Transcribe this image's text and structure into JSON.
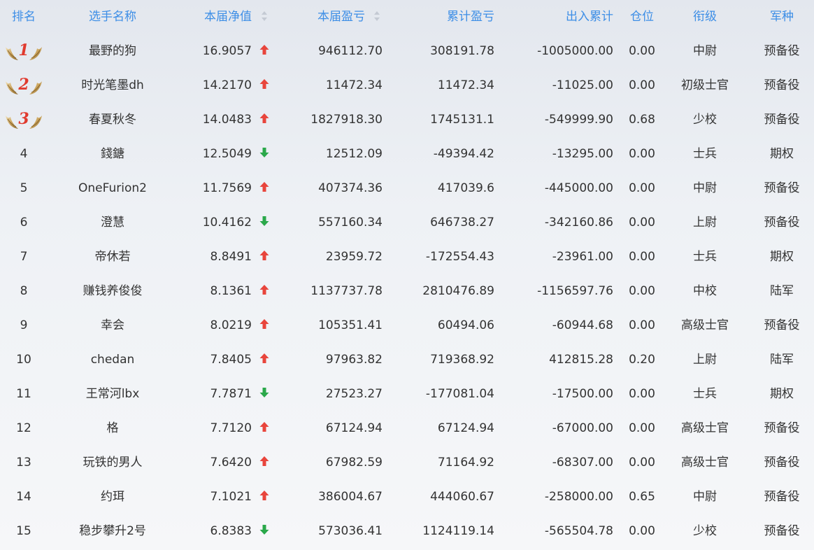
{
  "header": {
    "rank": "排名",
    "name": "选手名称",
    "nav": "本届净值",
    "current_pnl": "本届盈亏",
    "cumulative_pnl": "累计盈亏",
    "inout": "出入累计",
    "position": "仓位",
    "title": "衔级",
    "branch": "军种"
  },
  "colors": {
    "header_text": "#3d8ee6",
    "up_arrow": "#e8453c",
    "down_arrow": "#2aa84a",
    "medal_number": "#e03a2e",
    "sort_icon": "#c4cad3"
  },
  "rows": [
    {
      "rank": "1",
      "medal": true,
      "name": "最野的狗",
      "nav": "16.9057",
      "trend": "up",
      "current_pnl": "946112.70",
      "cumulative_pnl": "308191.78",
      "inout": "-1005000.00",
      "position": "0.00",
      "title": "中尉",
      "branch": "预备役"
    },
    {
      "rank": "2",
      "medal": true,
      "name": "时光笔墨dh",
      "nav": "14.2170",
      "trend": "up",
      "current_pnl": "11472.34",
      "cumulative_pnl": "11472.34",
      "inout": "-11025.00",
      "position": "0.00",
      "title": "初级士官",
      "branch": "预备役"
    },
    {
      "rank": "3",
      "medal": true,
      "name": "春夏秋冬",
      "nav": "14.0483",
      "trend": "up",
      "current_pnl": "1827918.30",
      "cumulative_pnl": "1745131.1",
      "inout": "-549999.90",
      "position": "0.68",
      "title": "少校",
      "branch": "预备役"
    },
    {
      "rank": "4",
      "medal": false,
      "name": "錢鎕",
      "nav": "12.5049",
      "trend": "down",
      "current_pnl": "12512.09",
      "cumulative_pnl": "-49394.42",
      "inout": "-13295.00",
      "position": "0.00",
      "title": "士兵",
      "branch": "期权"
    },
    {
      "rank": "5",
      "medal": false,
      "name": "OneFurion2",
      "nav": "11.7569",
      "trend": "up",
      "current_pnl": "407374.36",
      "cumulative_pnl": "417039.6",
      "inout": "-445000.00",
      "position": "0.00",
      "title": "中尉",
      "branch": "预备役"
    },
    {
      "rank": "6",
      "medal": false,
      "name": "澄慧",
      "nav": "10.4162",
      "trend": "down",
      "current_pnl": "557160.34",
      "cumulative_pnl": "646738.27",
      "inout": "-342160.86",
      "position": "0.00",
      "title": "上尉",
      "branch": "预备役"
    },
    {
      "rank": "7",
      "medal": false,
      "name": "帝休若",
      "nav": "8.8491",
      "trend": "up",
      "current_pnl": "23959.72",
      "cumulative_pnl": "-172554.43",
      "inout": "-23961.00",
      "position": "0.00",
      "title": "士兵",
      "branch": "期权"
    },
    {
      "rank": "8",
      "medal": false,
      "name": "赚钱养俊俊",
      "nav": "8.1361",
      "trend": "up",
      "current_pnl": "1137737.78",
      "cumulative_pnl": "2810476.89",
      "inout": "-1156597.76",
      "position": "0.00",
      "title": "中校",
      "branch": "陆军"
    },
    {
      "rank": "9",
      "medal": false,
      "name": "幸会",
      "nav": "8.0219",
      "trend": "up",
      "current_pnl": "105351.41",
      "cumulative_pnl": "60494.06",
      "inout": "-60944.68",
      "position": "0.00",
      "title": "高级士官",
      "branch": "预备役"
    },
    {
      "rank": "10",
      "medal": false,
      "name": "chedan",
      "nav": "7.8405",
      "trend": "up",
      "current_pnl": "97963.82",
      "cumulative_pnl": "719368.92",
      "inout": "412815.28",
      "position": "0.20",
      "title": "上尉",
      "branch": "陆军"
    },
    {
      "rank": "11",
      "medal": false,
      "name": "王常河lbx",
      "nav": "7.7871",
      "trend": "down",
      "current_pnl": "27523.27",
      "cumulative_pnl": "-177081.04",
      "inout": "-17500.00",
      "position": "0.00",
      "title": "士兵",
      "branch": "期权"
    },
    {
      "rank": "12",
      "medal": false,
      "name": "格",
      "nav": "7.7120",
      "trend": "up",
      "current_pnl": "67124.94",
      "cumulative_pnl": "67124.94",
      "inout": "-67000.00",
      "position": "0.00",
      "title": "高级士官",
      "branch": "预备役"
    },
    {
      "rank": "13",
      "medal": false,
      "name": "玩铁的男人",
      "nav": "7.6420",
      "trend": "up",
      "current_pnl": "67982.59",
      "cumulative_pnl": "71164.92",
      "inout": "-68307.00",
      "position": "0.00",
      "title": "高级士官",
      "branch": "预备役"
    },
    {
      "rank": "14",
      "medal": false,
      "name": "约珥",
      "nav": "7.1021",
      "trend": "up",
      "current_pnl": "386004.67",
      "cumulative_pnl": "444060.67",
      "inout": "-258000.00",
      "position": "0.65",
      "title": "中尉",
      "branch": "预备役"
    },
    {
      "rank": "15",
      "medal": false,
      "name": "稳步攀升2号",
      "nav": "6.8383",
      "trend": "down",
      "current_pnl": "573036.41",
      "cumulative_pnl": "1124119.14",
      "inout": "-565504.78",
      "position": "0.00",
      "title": "少校",
      "branch": "预备役"
    }
  ]
}
